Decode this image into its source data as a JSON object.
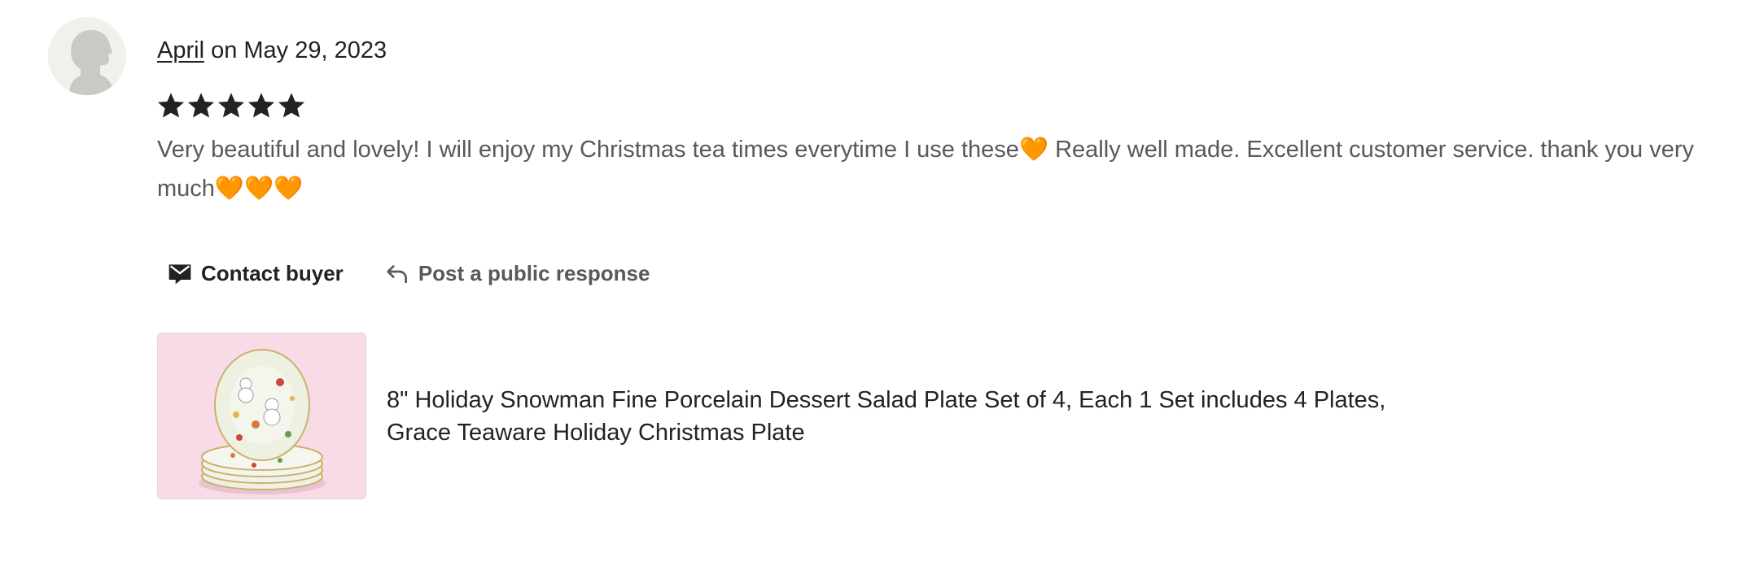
{
  "review": {
    "author": "April",
    "date_text": " on May 29, 2023",
    "rating": 5,
    "rating_max": 5,
    "text": "Very beautiful and lovely! I will enjoy my Christmas tea times everytime I use these🧡 Really well made. Excellent customer service. thank you very much🧡🧡🧡"
  },
  "actions": {
    "contact_label": "Contact buyer",
    "contact_icon": "envelope-icon",
    "respond_label": "Post a public response",
    "respond_icon": "reply-arrow-icon"
  },
  "product": {
    "title": "8\" Holiday Snowman Fine Porcelain Dessert Salad Plate Set of 4, Each 1 Set includes 4 Plates, Grace Teaware Holiday Christmas Plate"
  },
  "colors": {
    "star": "#222222",
    "text_primary": "#222222",
    "text_secondary": "#595959",
    "avatar_bg": "#f1f0ec",
    "thumb_bg": "#f9dbe7"
  }
}
